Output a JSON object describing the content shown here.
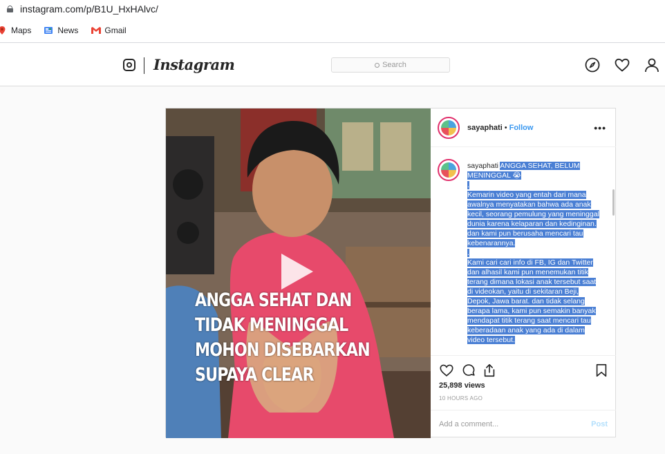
{
  "browser": {
    "url": "instagram.com/p/B1U_HxHAlvc/",
    "bookmarks": [
      {
        "label": "Maps",
        "icon": "maps-icon"
      },
      {
        "label": "News",
        "icon": "news-icon"
      },
      {
        "label": "Gmail",
        "icon": "gmail-icon"
      }
    ]
  },
  "header": {
    "wordmark": "Instagram",
    "search_placeholder": "Search",
    "icons": [
      "compass-icon",
      "heart-icon",
      "profile-icon"
    ]
  },
  "post": {
    "username": "sayaphati",
    "separator": "•",
    "follow_label": "Follow",
    "more_label": "•••",
    "video_overlay": [
      "ANGGA SEHAT DAN",
      "TIDAK MENINGGAL",
      "MOHON DISEBARKAN",
      "SUPAYA CLEAR"
    ],
    "caption": {
      "author": "sayaphati",
      "title": "ANGGA SEHAT, BELUM MENINGGAL 😭",
      "lines": [
        ".",
        "Kemarin video yang entah dari mana awalnya menyatakan bahwa ada anak kecil, seorang pemulung yang meninggal dunia karena kelaparan dan kedinginan. dan kami pun berusaha mencari tau kebenarannya.",
        ".",
        "Kami cari cari info di FB, IG dan Twitter dan alhasil kami pun menemukan titik terang dimana lokasi anak tersebut saat di videokan, yaitu di sekitaran Beji, Depok, Jawa barat. dan tidak selang berapa lama, kami pun semakin banyak mendapat titik terang saat mencari tau keberadaan anak yang ada di dalam video tersebut."
      ]
    },
    "views": "25,898 views",
    "time": "10 HOURS AGO",
    "comment_placeholder": "Add a comment...",
    "post_label": "Post",
    "colors": {
      "accent": "#3897f0",
      "selection": "#4a7fd4"
    }
  }
}
